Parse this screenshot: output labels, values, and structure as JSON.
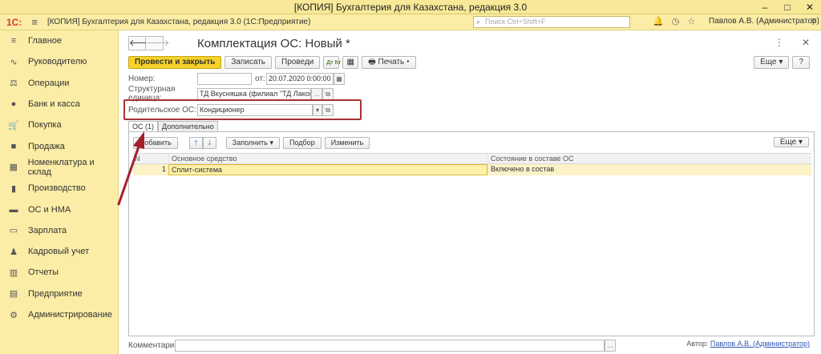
{
  "window": {
    "title": "[КОПИЯ] Бухгалтерия для Казахстана, редакция 3.0",
    "min": "–",
    "max": "□",
    "close": "✕"
  },
  "appbar": {
    "logo": "1С:",
    "menu_icon": "≡",
    "title": "[КОПИЯ] Бухгалтерия для Казахстана, редакция 3.0  (1С:Предприятие)",
    "search_placeholder": "Поиск Ctrl+Shift+F",
    "user": "Павлов А.В. (Администратор)"
  },
  "sidebar": {
    "items": [
      {
        "label": "Главное",
        "icon": "≡"
      },
      {
        "label": "Руководителю",
        "icon": "∿"
      },
      {
        "label": "Операции",
        "icon": "⚖"
      },
      {
        "label": "Банк и касса",
        "icon": "●"
      },
      {
        "label": "Покупка",
        "icon": "🛒"
      },
      {
        "label": "Продажа",
        "icon": "■"
      },
      {
        "label": "Номенклатура и склад",
        "icon": "▦"
      },
      {
        "label": "Производство",
        "icon": "▮"
      },
      {
        "label": "ОС и НМА",
        "icon": "▬"
      },
      {
        "label": "Зарплата",
        "icon": "▭"
      },
      {
        "label": "Кадровый учет",
        "icon": "♟"
      },
      {
        "label": "Отчеты",
        "icon": "▥"
      },
      {
        "label": "Предприятие",
        "icon": "▤"
      },
      {
        "label": "Администрирование",
        "icon": "⚙"
      }
    ]
  },
  "doc": {
    "title": "Комплектация ОС: Новый *",
    "toolbar": {
      "post_close": "Провести и закрыть",
      "save": "Записать",
      "post": "Проведи",
      "dt_label": "Дт Кт",
      "print": "Печать",
      "more": "Еще",
      "help": "?"
    },
    "fields": {
      "number_label": "Номер:",
      "number_value": "",
      "date_label": "от:",
      "date_value": "20.07.2020  0:00:00",
      "unit_label": "Структурная единица:",
      "unit_value": "ТД Вкусняшка (филиал \"ТД Лакомк",
      "parent_label": "Родительское ОС:",
      "parent_value": "Кондиционер"
    },
    "tabs": [
      {
        "label": "ОС (1)"
      },
      {
        "label": "Дополнительно"
      }
    ],
    "table_toolbar": {
      "add": "Добавить",
      "fill": "Заполнить",
      "pick": "Подбор",
      "change": "Изменить",
      "more": "Еще"
    },
    "table": {
      "headers": [
        "N",
        "Основное средство",
        "Состояние в составе ОС"
      ],
      "rows": [
        {
          "n": "1",
          "asset": "Сплит-система",
          "state": "Включено в состав"
        }
      ]
    },
    "footer": {
      "comment_label": "Комментарий:",
      "comment_value": "",
      "author_label": "Автор:",
      "author_value": "Павлов А.В. (Администратор)"
    }
  },
  "colors": {
    "accent": "#f6d22a",
    "sidebar": "#fbeda6",
    "highlight_box": "#a83232",
    "annotation_arrow": "#a51f2b"
  }
}
